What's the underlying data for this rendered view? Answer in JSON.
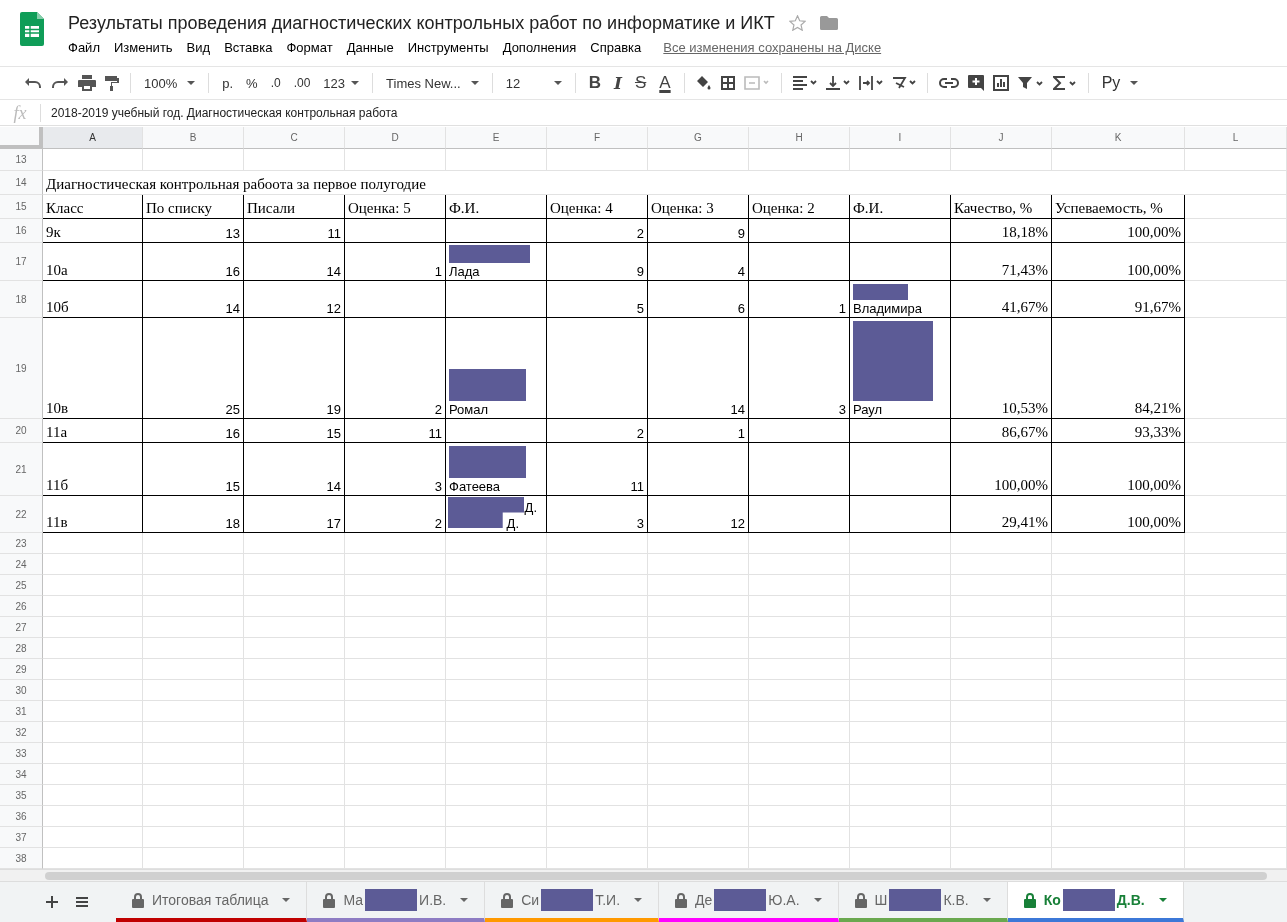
{
  "document": {
    "title": "Результаты проведения диагностических контрольных работ по информатике и ИКТ",
    "starred": false,
    "save_status": "Все изменения сохранены на Диске"
  },
  "menu": [
    "Файл",
    "Изменить",
    "Вид",
    "Вставка",
    "Формат",
    "Данные",
    "Инструменты",
    "Дополнения",
    "Справка"
  ],
  "toolbar": {
    "zoom": "100%",
    "currency": "р.",
    "percent": "%",
    "decimal_less": ".0",
    "decimal_more": ".00",
    "number_format": "123",
    "font": "Times New...",
    "font_size": "12",
    "bold": "B",
    "italic": "I",
    "strike": "S",
    "text_color": "A",
    "input_tools": "Ру"
  },
  "formula_bar": {
    "label": "fx",
    "value": "2018-2019 учебный год. Диагностическая контрольная работа"
  },
  "columns": [
    {
      "label": "A",
      "selected": true
    },
    {
      "label": "B",
      "selected": false
    },
    {
      "label": "C",
      "selected": false
    },
    {
      "label": "D",
      "selected": false
    },
    {
      "label": "E",
      "selected": false
    },
    {
      "label": "F",
      "selected": false
    },
    {
      "label": "G",
      "selected": false
    },
    {
      "label": "H",
      "selected": false
    },
    {
      "label": "I",
      "selected": false
    },
    {
      "label": "J",
      "selected": false
    },
    {
      "label": "K",
      "selected": false
    },
    {
      "label": "L",
      "selected": false
    }
  ],
  "rows": [
    {
      "number": "13"
    },
    {
      "number": "14",
      "title": "Диагностическая контрольная рабоота за первое полугодие"
    },
    {
      "number": "15",
      "bordered": true,
      "cells": [
        {
          "kind": "label",
          "text": "Класс"
        },
        {
          "kind": "label",
          "text": "По списку"
        },
        {
          "kind": "label",
          "text": "Писали"
        },
        {
          "kind": "label",
          "text": "Оценка: 5"
        },
        {
          "kind": "label",
          "text": "Ф.И."
        },
        {
          "kind": "label",
          "text": "Оценка: 4"
        },
        {
          "kind": "label",
          "text": "Оценка: 3"
        },
        {
          "kind": "label",
          "text": "Оценка: 2"
        },
        {
          "kind": "label",
          "text": "Ф.И."
        },
        {
          "kind": "label",
          "text": "Качество, %"
        },
        {
          "kind": "label",
          "text": "Успеваемость, %"
        }
      ]
    },
    {
      "number": "16",
      "bordered": true,
      "cells": [
        {
          "kind": "label",
          "text": "9к"
        },
        {
          "kind": "number",
          "text": "13"
        },
        {
          "kind": "number",
          "text": "11"
        },
        null,
        null,
        {
          "kind": "number",
          "text": "2"
        },
        {
          "kind": "number",
          "text": "9"
        },
        null,
        null,
        {
          "kind": "percent",
          "text": "18,18%"
        },
        {
          "kind": "percent",
          "text": "100,00%"
        }
      ]
    },
    {
      "number": "17",
      "bordered": true,
      "cells": [
        {
          "kind": "label",
          "text": "10а"
        },
        {
          "kind": "number",
          "text": "16"
        },
        {
          "kind": "number",
          "text": "14"
        },
        {
          "kind": "number",
          "text": "1"
        },
        {
          "kind": "name",
          "lines": [
            "Лада"
          ],
          "redacted": true
        },
        {
          "kind": "number",
          "text": "9"
        },
        {
          "kind": "number",
          "text": "4"
        },
        null,
        null,
        {
          "kind": "percent",
          "text": "71,43%"
        },
        {
          "kind": "percent",
          "text": "100,00%"
        }
      ]
    },
    {
      "number": "18",
      "bordered": true,
      "cells": [
        {
          "kind": "label",
          "text": "10б"
        },
        {
          "kind": "number",
          "text": "14"
        },
        {
          "kind": "number",
          "text": "12"
        },
        null,
        null,
        {
          "kind": "number",
          "text": "5"
        },
        {
          "kind": "number",
          "text": "6"
        },
        {
          "kind": "number",
          "text": "1"
        },
        {
          "kind": "name",
          "lines": [
            "Владимира"
          ],
          "redacted": true
        },
        {
          "kind": "percent",
          "text": "41,67%"
        },
        {
          "kind": "percent",
          "text": "91,67%"
        }
      ]
    },
    {
      "number": "19",
      "bordered": true,
      "cells": [
        {
          "kind": "label",
          "text": "10в"
        },
        {
          "kind": "number",
          "text": "25"
        },
        {
          "kind": "number",
          "text": "19"
        },
        {
          "kind": "number",
          "text": "2"
        },
        {
          "kind": "name",
          "lines": [
            "Ромал"
          ],
          "redacted": true
        },
        null,
        {
          "kind": "number",
          "text": "14"
        },
        {
          "kind": "number",
          "text": "3"
        },
        {
          "kind": "name",
          "lines": [
            "Раул"
          ],
          "redacted": true
        },
        {
          "kind": "percent",
          "text": "10,53%"
        },
        {
          "kind": "percent",
          "text": "84,21%"
        }
      ]
    },
    {
      "number": "20",
      "bordered": true,
      "cells": [
        {
          "kind": "label",
          "text": "11а"
        },
        {
          "kind": "number",
          "text": "16"
        },
        {
          "kind": "number",
          "text": "15"
        },
        {
          "kind": "number",
          "text": "11"
        },
        null,
        {
          "kind": "number",
          "text": "2"
        },
        {
          "kind": "number",
          "text": "1"
        },
        null,
        null,
        {
          "kind": "percent",
          "text": "86,67%"
        },
        {
          "kind": "percent",
          "text": "93,33%"
        }
      ]
    },
    {
      "number": "21",
      "bordered": true,
      "cells": [
        {
          "kind": "label",
          "text": "11б"
        },
        {
          "kind": "number",
          "text": "15"
        },
        {
          "kind": "number",
          "text": "14"
        },
        {
          "kind": "number",
          "text": "3"
        },
        {
          "kind": "name",
          "lines": [
            "Фатеева"
          ],
          "redacted": true
        },
        {
          "kind": "number",
          "text": "11"
        },
        null,
        null,
        null,
        {
          "kind": "percent",
          "text": "100,00%"
        },
        {
          "kind": "percent",
          "text": "100,00%"
        }
      ]
    },
    {
      "number": "22",
      "bordered": true,
      "cells": [
        {
          "kind": "label",
          "text": "11в"
        },
        {
          "kind": "number",
          "text": "18"
        },
        {
          "kind": "number",
          "text": "17"
        },
        {
          "kind": "number",
          "text": "2"
        },
        {
          "kind": "name",
          "lines": [
            "Д.",
            "Д."
          ],
          "redacted": true
        },
        {
          "kind": "number",
          "text": "3"
        },
        {
          "kind": "number",
          "text": "12"
        },
        null,
        null,
        {
          "kind": "percent",
          "text": "29,41%"
        },
        {
          "kind": "percent",
          "text": "100,00%"
        }
      ]
    },
    {
      "number": "23"
    },
    {
      "number": "24"
    },
    {
      "number": "25"
    },
    {
      "number": "26"
    },
    {
      "number": "27"
    },
    {
      "number": "28"
    },
    {
      "number": "29"
    },
    {
      "number": "30"
    },
    {
      "number": "31"
    },
    {
      "number": "32"
    },
    {
      "number": "33"
    },
    {
      "number": "34"
    },
    {
      "number": "35"
    },
    {
      "number": "36"
    },
    {
      "number": "37"
    },
    {
      "number": "38"
    }
  ],
  "sheets": [
    {
      "before": "Итоговая таблица",
      "redacted": false,
      "locked": true,
      "selected": false,
      "color": "#c00000"
    },
    {
      "before": "Ма",
      "after": "И.В.",
      "redacted": true,
      "locked": true,
      "selected": false,
      "color": "#8e7cc3"
    },
    {
      "before": "Си",
      "after": "Т.И.",
      "redacted": true,
      "locked": true,
      "selected": false,
      "color": "#ff9900"
    },
    {
      "before": "Де",
      "after": "Ю.А.",
      "redacted": true,
      "locked": true,
      "selected": false,
      "color": "#ff00ff"
    },
    {
      "before": "Ш",
      "after": "К.В.",
      "redacted": true,
      "locked": true,
      "selected": false,
      "color": "#6aa84f"
    },
    {
      "before": "Ко",
      "after": "Д.В.",
      "redacted": true,
      "locked": true,
      "selected": true,
      "color": "#3c78d8"
    }
  ]
}
